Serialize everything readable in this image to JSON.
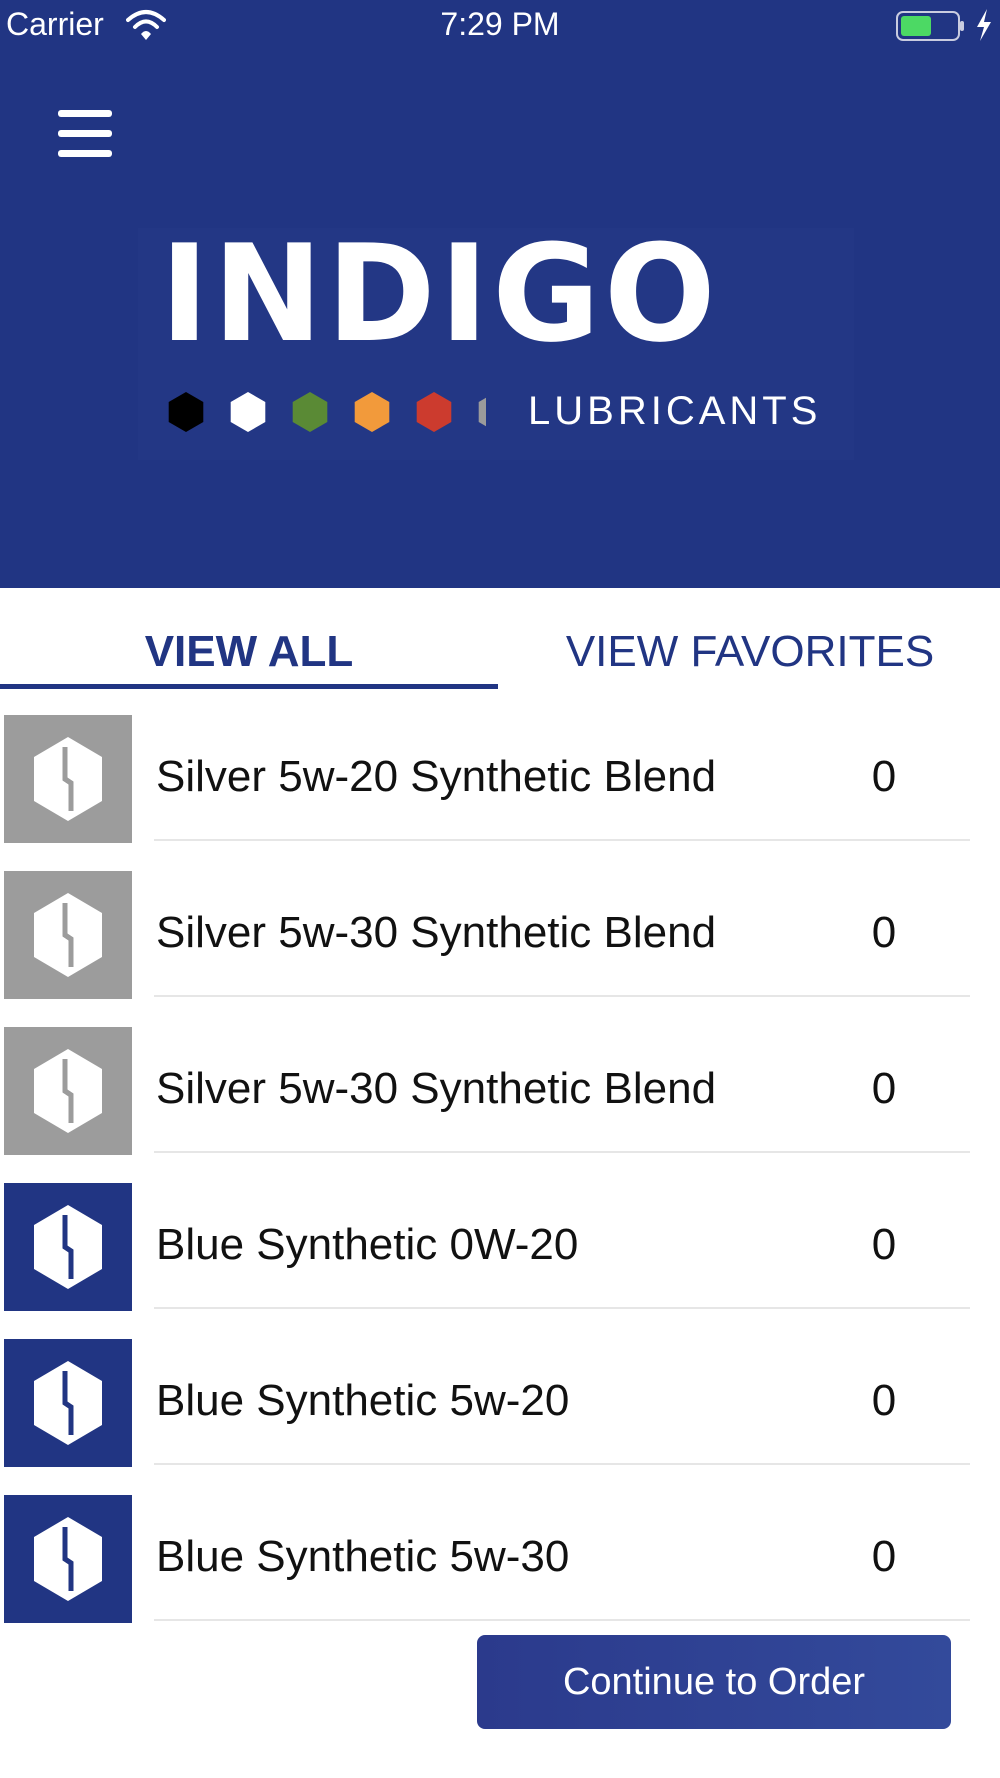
{
  "status_bar": {
    "carrier": "Carrier",
    "time": "7:29 PM"
  },
  "header": {
    "menu_icon": "hamburger-menu-icon",
    "logo": {
      "wordmark": "INDIGO",
      "subtitle": "LUBRICANTS"
    },
    "logo_hex_colors": [
      "#000000",
      "#ffffff",
      "#5a8a35",
      "#f29a3b",
      "#cc3b2e",
      "#9b9b9b"
    ]
  },
  "tabs": [
    {
      "label": "VIEW ALL",
      "selected": true
    },
    {
      "label": "VIEW FAVORITES",
      "selected": false
    }
  ],
  "products": [
    {
      "name": "Silver 5w-20 Synthetic Blend",
      "qty": "0",
      "color": "silver",
      "icon": "indigo-hex-logo-icon"
    },
    {
      "name": "Silver 5w-30 Synthetic Blend",
      "qty": "0",
      "color": "silver",
      "icon": "indigo-hex-logo-icon"
    },
    {
      "name": "Silver 5w-30 Synthetic Blend",
      "qty": "0",
      "color": "silver",
      "icon": "indigo-hex-logo-icon"
    },
    {
      "name": "Blue Synthetic 0W-20",
      "qty": "0",
      "color": "blue",
      "icon": "indigo-hex-logo-icon"
    },
    {
      "name": "Blue Synthetic 5w-20",
      "qty": "0",
      "color": "blue",
      "icon": "indigo-hex-logo-icon"
    },
    {
      "name": "Blue Synthetic 5w-30",
      "qty": "0",
      "color": "blue",
      "icon": "indigo-hex-logo-icon"
    }
  ],
  "footer": {
    "continue_label": "Continue to Order"
  },
  "colors": {
    "primary": "#213583",
    "silver": "#9c9c9c",
    "battery": "#4cd964"
  }
}
